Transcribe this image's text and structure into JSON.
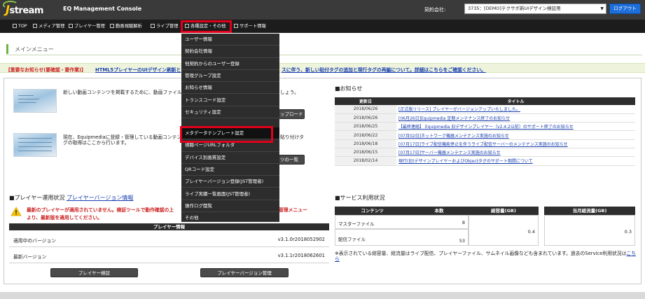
{
  "header": {
    "logo_j": "J",
    "logo_rest": "stream",
    "console_title": "EQ Management Console",
    "company_label": "契約会社:",
    "company_value": "3735：[DEMO]テクサポ新UIデザイン検証用",
    "logout": "ログアウト"
  },
  "nav": {
    "items": [
      {
        "label": "TOP"
      },
      {
        "label": "メディア管理"
      },
      {
        "label": "プレイヤー管理"
      },
      {
        "label": "動画視聴解析"
      },
      {
        "label": "ライブ管理"
      },
      {
        "label": "各種設定・その他"
      },
      {
        "label": "サポート情報"
      }
    ]
  },
  "main_menu": {
    "title": "メインメニュー"
  },
  "notice": {
    "label": "【重要なお知らせ(要確認・要作業)】",
    "link_part1": "HTML5プレイヤーのUIデザイン刷新と",
    "link_part2": "スに伴う、新しい貼付タグの追加と現行タグの再編について。詳細はこちらをご確認ください。"
  },
  "left": {
    "item1_text": "新しい動画コンテンツを掲載するために、動画ファイル",
    "item1_text_end": "しょう。",
    "item2_text_line1": "現在、Equipmediaに登録・管理している動画コンテン",
    "item2_text_line2": "グの取得はここから行います。",
    "item2_text_end_line1": "貼り付けタ",
    "upload_btn": "ップロード",
    "list_btn": "ツの一覧",
    "player_title": "■プレイヤー運用状況",
    "player_link": "プレイヤーバージョン情報",
    "warn_line1": "最新のプレイヤーが適用されていません。検証ツールで動作確認の上",
    "warn_line2": "より、最新版を適用してください。",
    "warn_right": "管理メニュー",
    "info_header": "プレイヤー情報",
    "rows": [
      {
        "label": "適用中のバージョン",
        "value": "v3.1.0r2018052902"
      },
      {
        "label": "最新バージョン",
        "value": "v3.1.1r2018062601"
      }
    ],
    "btn_verify": "プレイヤー検証",
    "btn_version_mgmt": "プレイヤーバージョン管理"
  },
  "news": {
    "title": "■お知らせ",
    "col_date": "更新日",
    "col_title": "タイトル",
    "items": [
      {
        "date": "2018/06/26",
        "title": "[正式版リリース] プレイヤーがバージョンアップいたしました。"
      },
      {
        "date": "2018/06/26",
        "title": "[06月26日]Equipmedia 定期メンテナンス終了のお知らせ"
      },
      {
        "date": "2018/06/25",
        "title": "【最終連絡】 Equipmedia 旧デザインプレイヤー（v2.4.2以前）のサポート終了のお知らせ"
      },
      {
        "date": "2018/06/22",
        "title": "[07月02日]ネットワーク機器メンテナンス実施のお知らせ"
      },
      {
        "date": "2018/06/18",
        "title": "[07月17日]ライブ配信機能停止を伴うライブ配信サーバーのメンテナンス実施のお知らせ"
      },
      {
        "date": "2018/06/15",
        "title": "[07月17日]サーバー機器メンテナンス実施のお知らせ"
      },
      {
        "date": "2018/02/14",
        "title": "現行(旧)デザインプレイヤーおよびObjectタグのサポート期間について"
      }
    ]
  },
  "service": {
    "title": "■サービス利用状況",
    "col_content": "コンテンツ",
    "col_count": "本数",
    "col_total": "総容量(GB)",
    "col_month": "当月総流量(GB)",
    "master_label": "マスターファイル",
    "master_count": "8",
    "delivery_label": "配信ファイル",
    "delivery_count": "53",
    "total_value": "0.4",
    "month_value": "0.3",
    "note": "※表示されている総容量、総流量はライブ配信、プレイヤーファイル、サムネイル画像なども含まれています。過去のService利用状況は",
    "note_link": "こちら"
  },
  "dropdown": {
    "items": [
      {
        "label": "ユーザー情報"
      },
      {
        "label": "契約会社情報"
      },
      {
        "label": "他契約からのユーザー登録"
      },
      {
        "label": "管理グループ設定"
      },
      {
        "label": "お知らせ情報"
      },
      {
        "label": "トランスコード設定"
      },
      {
        "label": "セキュリティ設定"
      },
      {
        "label": "メタデータテンプレート設定"
      },
      {
        "label": "視聴ページURLフォルダ"
      },
      {
        "label": "デバイス別画質設定"
      },
      {
        "label": "QRコード設定"
      },
      {
        "label": "プレイヤーバージョン登録(JST管理者)"
      },
      {
        "label": "ライブ実績一覧画面(JST管理者)"
      },
      {
        "label": "操作ログ閲覧"
      },
      {
        "label": "その他"
      }
    ]
  },
  "colors": {
    "accent_blue": "#1e6fd9",
    "highlight_red": "#e0001b",
    "brand_green": "#6db33f"
  }
}
